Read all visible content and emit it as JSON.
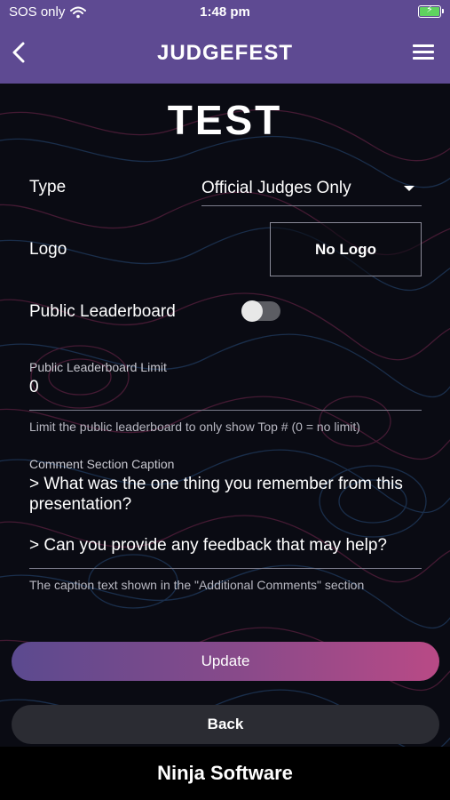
{
  "status": {
    "carrier": "SOS only",
    "time": "1:48 pm",
    "battery_color": "#5fd35f"
  },
  "nav": {
    "title": "JUDGEFEST",
    "back_icon": "chevron-left-icon",
    "menu_icon": "hamburger-menu-icon"
  },
  "page": {
    "title": "TEST"
  },
  "form": {
    "type_label": "Type",
    "type_value": "Official Judges Only",
    "logo_label": "Logo",
    "logo_button": "No Logo",
    "public_leaderboard_label": "Public Leaderboard",
    "public_leaderboard_on": false,
    "limit_label": "Public Leaderboard Limit",
    "limit_value": "0",
    "limit_help": "Limit the public leaderboard to only show Top # (0 = no limit)",
    "comment_label": "Comment Section Caption",
    "comment_value": "> What was the one thing you remember from this presentation?\n\n> Can you provide any feedback that may help?",
    "comment_help": "The caption text shown in the \"Additional Comments\" section"
  },
  "actions": {
    "update_label": "Update",
    "back_label": "Back"
  },
  "footer": {
    "brand": "Ninja Software"
  },
  "colors": {
    "header_bg": "#5e4a92",
    "gradient_start": "#5b4a8f",
    "gradient_end": "#b94a86"
  }
}
